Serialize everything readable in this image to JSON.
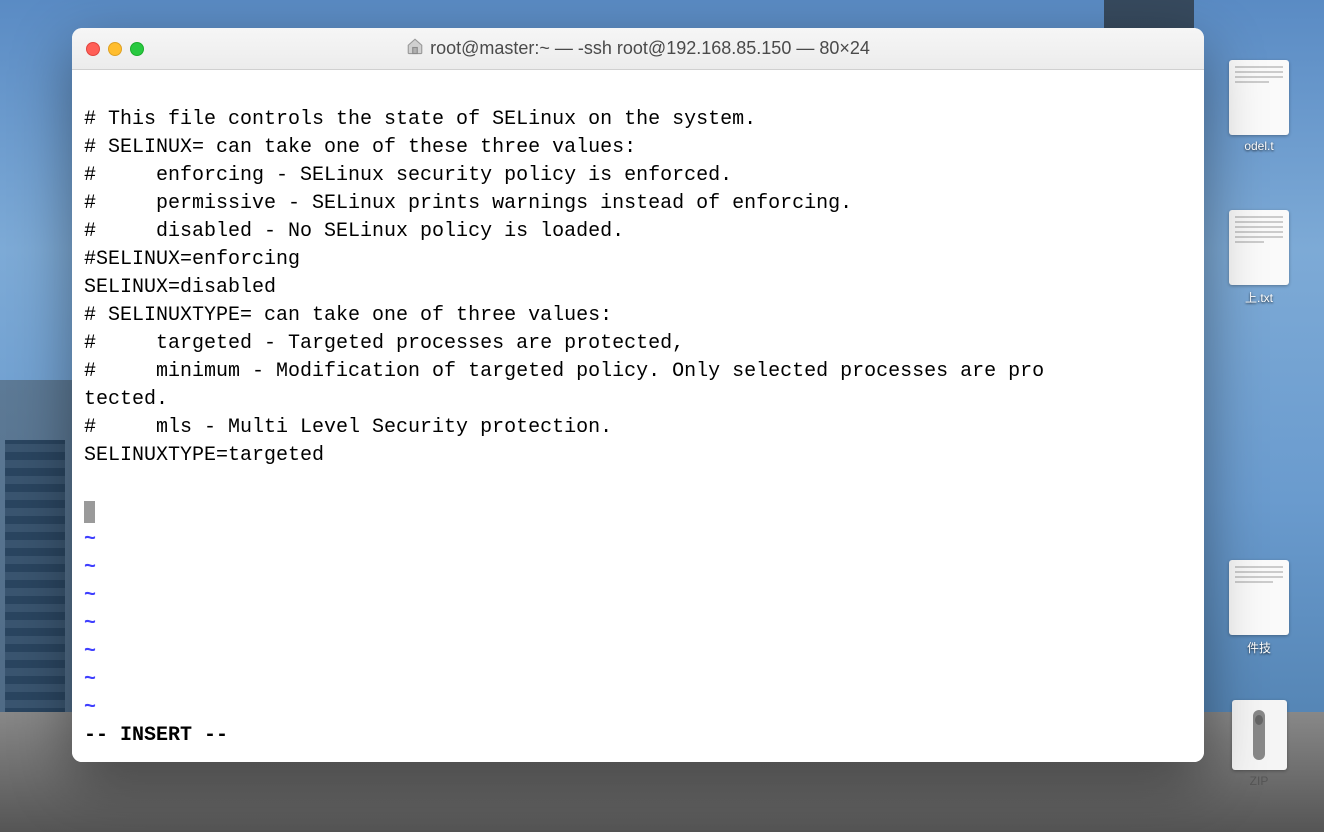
{
  "window": {
    "title": "root@master:~ — -ssh root@192.168.85.150 — 80×24"
  },
  "terminal": {
    "lines": [
      "",
      "# This file controls the state of SELinux on the system.",
      "# SELINUX= can take one of these three values:",
      "#     enforcing - SELinux security policy is enforced.",
      "#     permissive - SELinux prints warnings instead of enforcing.",
      "#     disabled - No SELinux policy is loaded.",
      "#SELINUX=enforcing",
      "SELINUX=disabled",
      "# SELINUXTYPE= can take one of three values:",
      "#     targeted - Targeted processes are protected,",
      "#     minimum - Modification of targeted policy. Only selected processes are pro",
      "tected.",
      "#     mls - Multi Level Security protection.",
      "SELINUXTYPE=targeted"
    ],
    "tilde_count": 7,
    "status": "-- INSERT --"
  },
  "desktop_files": {
    "file1_label": "odel.t",
    "file2_label": "上.txt",
    "file3_label": "件技",
    "file4_label": "ZIP"
  }
}
